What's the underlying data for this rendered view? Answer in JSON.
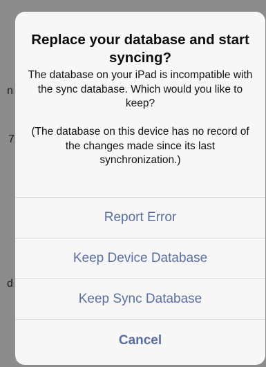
{
  "background": {
    "fragments": [
      "n",
      "7",
      "d"
    ]
  },
  "alert": {
    "title": "Replace your database and start syncing?",
    "message": "The database on your iPad is incompatible with the sync database. Which would you like to keep?\n\n(The database on this device has no record of the changes made since its last synchronization.)",
    "buttons": [
      {
        "label": "Report Error"
      },
      {
        "label": "Keep Device Database"
      },
      {
        "label": "Keep Sync Database"
      },
      {
        "label": "Cancel"
      }
    ]
  },
  "colors": {
    "button_text": "#5a6f9e",
    "alert_background": "#f7f7f7",
    "overlay": "#8c8c8c"
  }
}
